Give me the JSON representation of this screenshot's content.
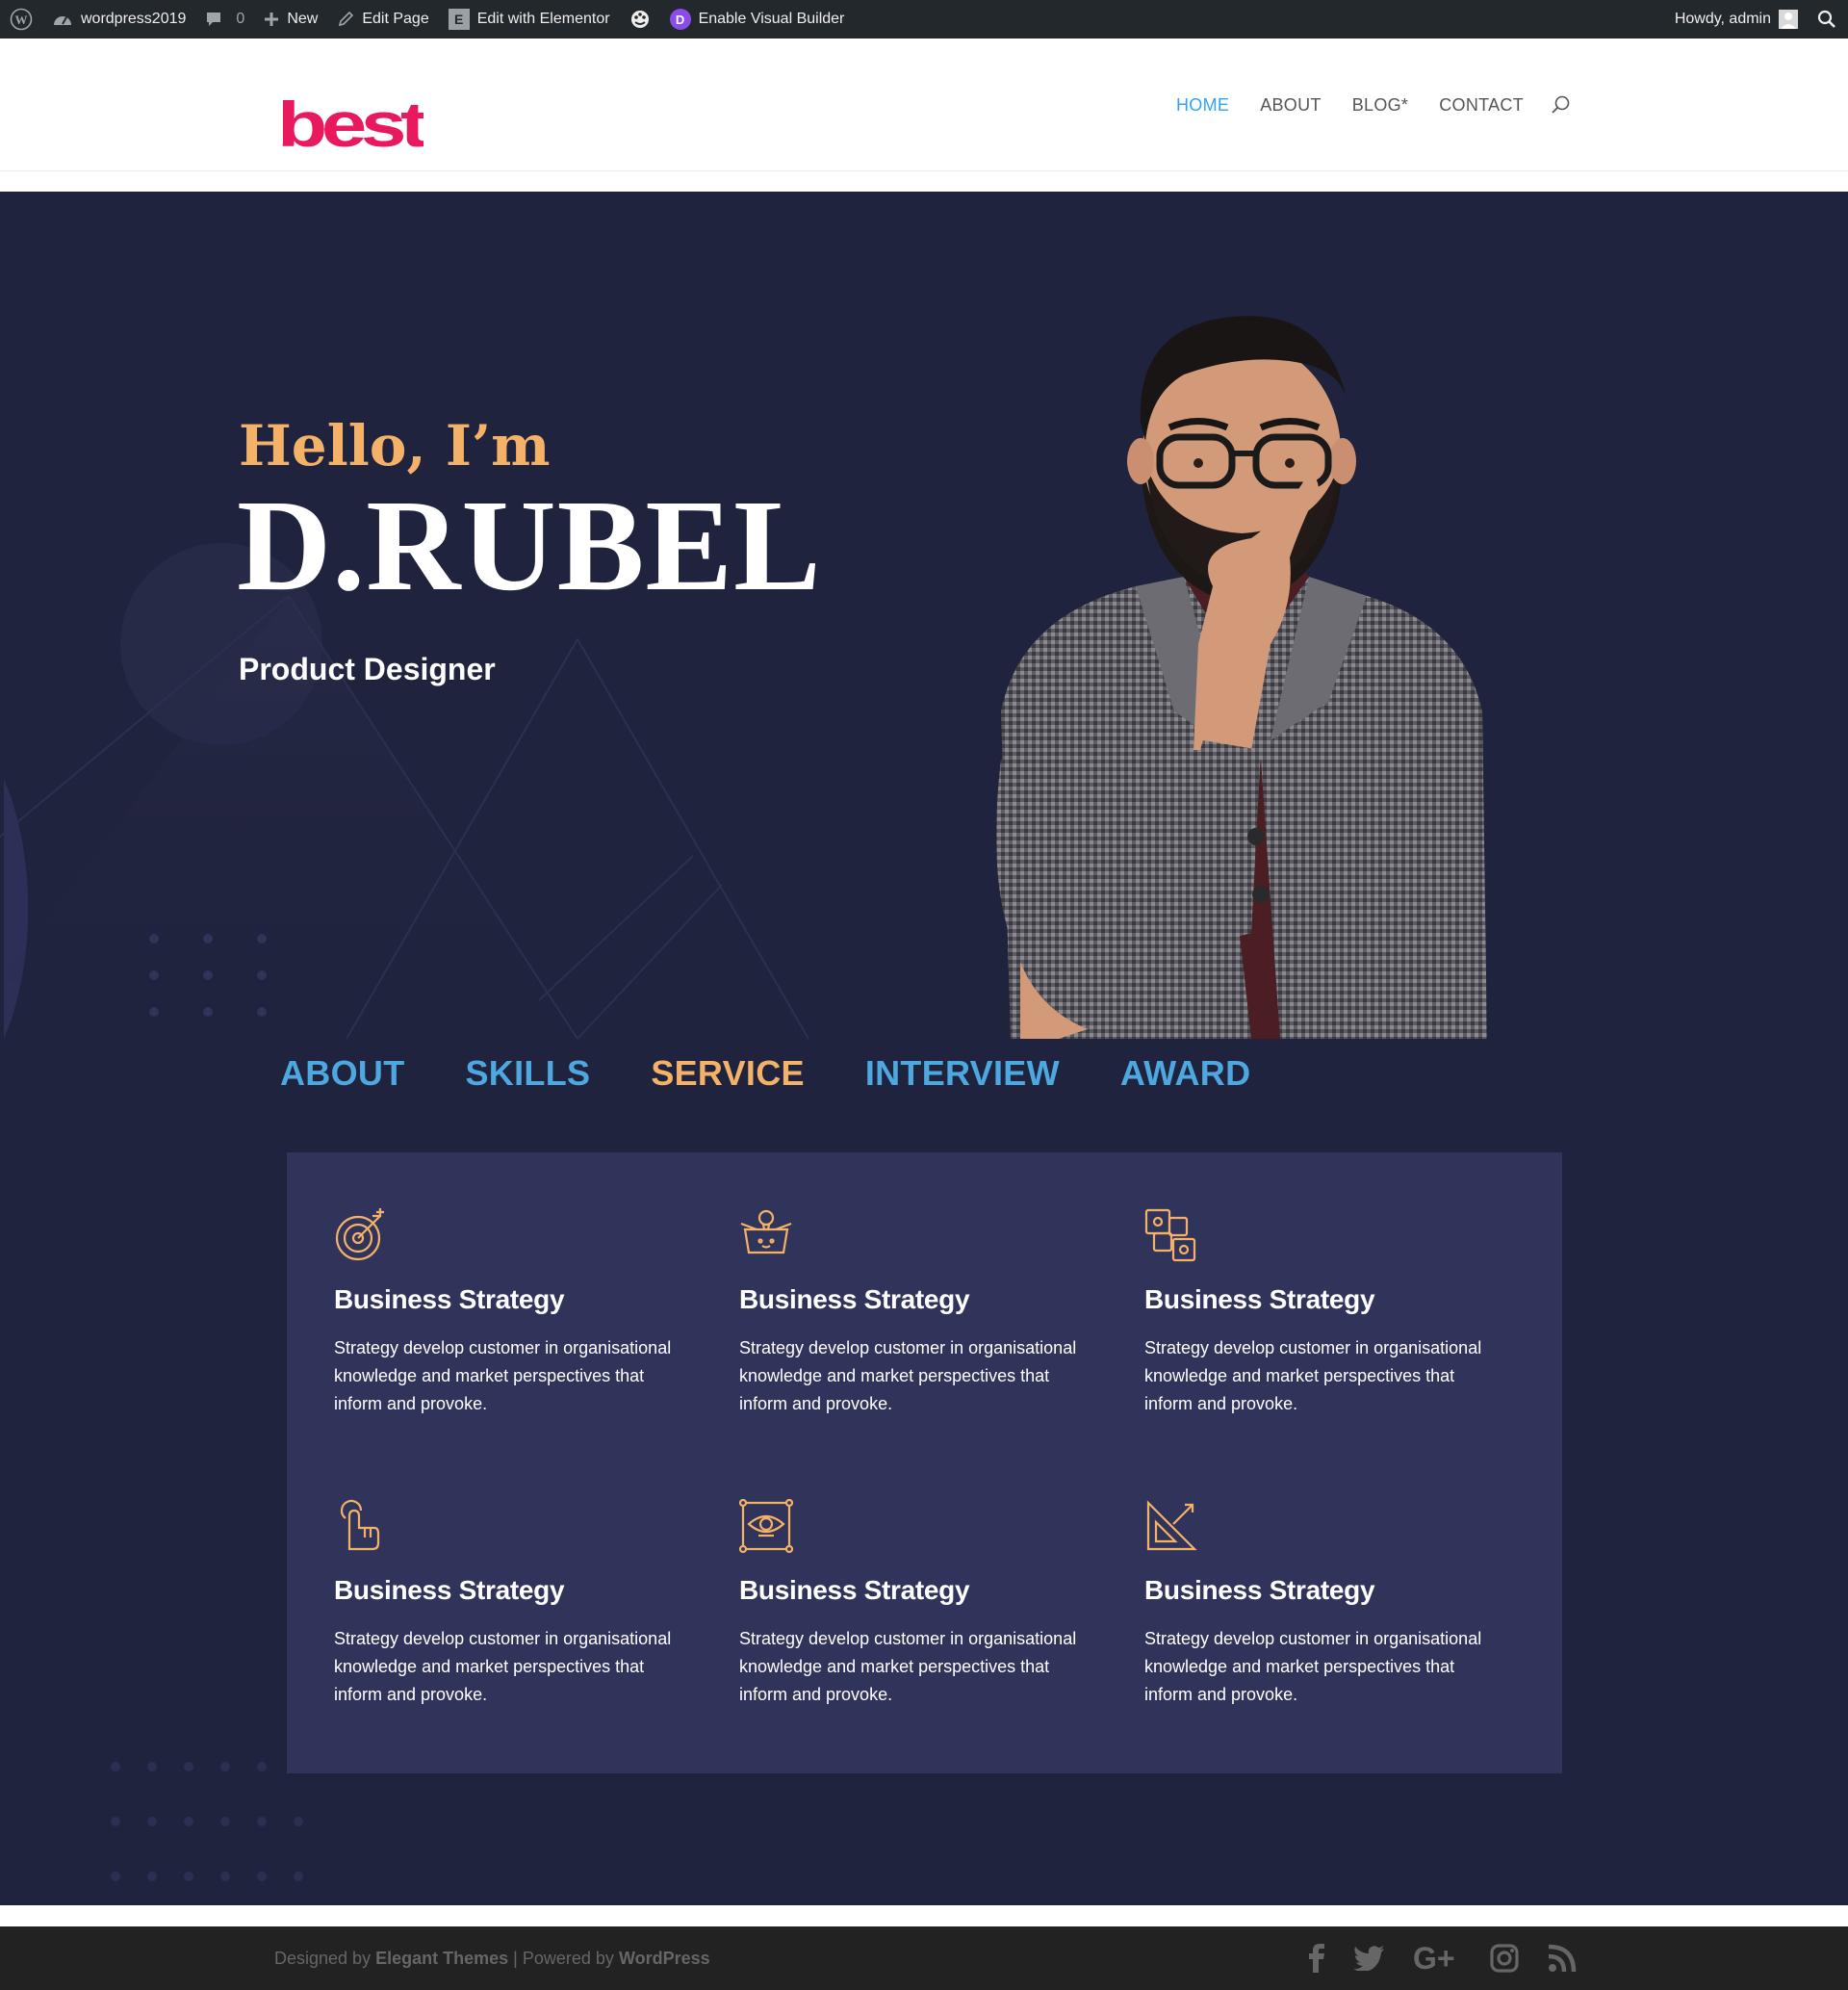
{
  "adminbar": {
    "site_name": "wordpress2019",
    "comments_count": "0",
    "new_label": "New",
    "edit_page_label": "Edit Page",
    "elementor_label": "Edit with Elementor",
    "visual_builder_label": "Enable Visual Builder",
    "greeting": "Howdy, admin"
  },
  "header": {
    "logo_text": "best",
    "nav": [
      {
        "label": "HOME",
        "active": true
      },
      {
        "label": "ABOUT"
      },
      {
        "label": "BLOG*"
      },
      {
        "label": "CONTACT"
      }
    ]
  },
  "hero": {
    "greeting": "Hello, I’m",
    "name": "D.RUBEL",
    "role": "Product Designer"
  },
  "tabs": [
    {
      "label": "ABOUT"
    },
    {
      "label": "SKILLS"
    },
    {
      "label": "SERVICE",
      "active": true
    },
    {
      "label": "INTERVIEW"
    },
    {
      "label": "AWARD"
    }
  ],
  "services": [
    {
      "icon": "target-icon",
      "title": "Business Strategy",
      "desc": "Strategy develop customer in organisational knowledge and market perspectives that inform and provoke."
    },
    {
      "icon": "idea-box-icon",
      "title": "Business Strategy",
      "desc": "Strategy develop customer in organisational knowledge and market perspectives that inform and provoke."
    },
    {
      "icon": "puzzle-icon",
      "title": "Business Strategy",
      "desc": "Strategy develop customer in organisational knowledge and market perspectives that inform and provoke."
    },
    {
      "icon": "touch-icon",
      "title": "Business Strategy",
      "desc": "Strategy develop customer in organisational knowledge and market perspectives that inform and provoke."
    },
    {
      "icon": "vision-icon",
      "title": "Business Strategy",
      "desc": "Strategy develop customer in organisational knowledge and market perspectives that inform and provoke."
    },
    {
      "icon": "design-tools-icon",
      "title": "Business Strategy",
      "desc": "Strategy develop customer in organisational knowledge and market perspectives that inform and provoke."
    }
  ],
  "footer": {
    "designed_by": "Designed by",
    "designer": "Elegant Themes",
    "separator": "|",
    "powered_by": "Powered by",
    "platform": "WordPress",
    "social": [
      "facebook-icon",
      "twitter-icon",
      "google-plus-icon",
      "instagram-icon",
      "rss-icon"
    ]
  },
  "colors": {
    "hero_bg": "#20233d",
    "card_bg": "#31345a",
    "accent_orange": "#f3b267",
    "accent_blue": "#4ea8e0",
    "nav_active": "#2ea3f2",
    "logo_pink": "#e8195d"
  }
}
